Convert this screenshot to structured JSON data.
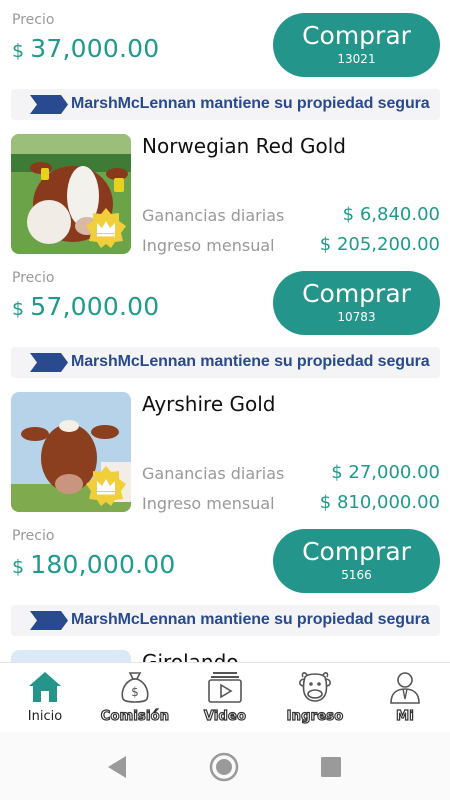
{
  "cards": [
    {
      "name": "",
      "price_label": "Precio",
      "currency": "$",
      "price": "37,000.00",
      "buy_label": "Comprar",
      "buy_count": "13021",
      "banner": "MarshMcLennan mantiene su propiedad segura"
    },
    {
      "name": "Norwegian Red Gold",
      "daily_label": "Ganancias diarias",
      "daily_value": "$ 6,840.00",
      "monthly_label": "Ingreso mensual",
      "monthly_value": "$ 205,200.00",
      "price_label": "Precio",
      "currency": "$",
      "price": "57,000.00",
      "buy_label": "Comprar",
      "buy_count": "10783",
      "banner": "MarshMcLennan mantiene su propiedad segura"
    },
    {
      "name": "Ayrshire Gold",
      "daily_label": "Ganancias diarias",
      "daily_value": "$ 27,000.00",
      "monthly_label": "Ingreso mensual",
      "monthly_value": "$ 810,000.00",
      "price_label": "Precio",
      "currency": "$",
      "price": "180,000.00",
      "buy_label": "Comprar",
      "buy_count": "5166",
      "banner": "MarshMcLennan mantiene su propiedad segura"
    },
    {
      "name": "Girolando"
    }
  ],
  "tabs": [
    {
      "label": "Inicio",
      "icon": "home-icon",
      "active": true
    },
    {
      "label": "Comisión",
      "icon": "money-bag-icon"
    },
    {
      "label": "Video",
      "icon": "video-icon"
    },
    {
      "label": "Ingreso",
      "icon": "cow-icon"
    },
    {
      "label": "Mi",
      "icon": "user-icon"
    }
  ],
  "colors": {
    "accent": "#24958a",
    "price_text": "#1f9a8c",
    "banner_text": "#2a4a8f",
    "muted": "#999999"
  }
}
